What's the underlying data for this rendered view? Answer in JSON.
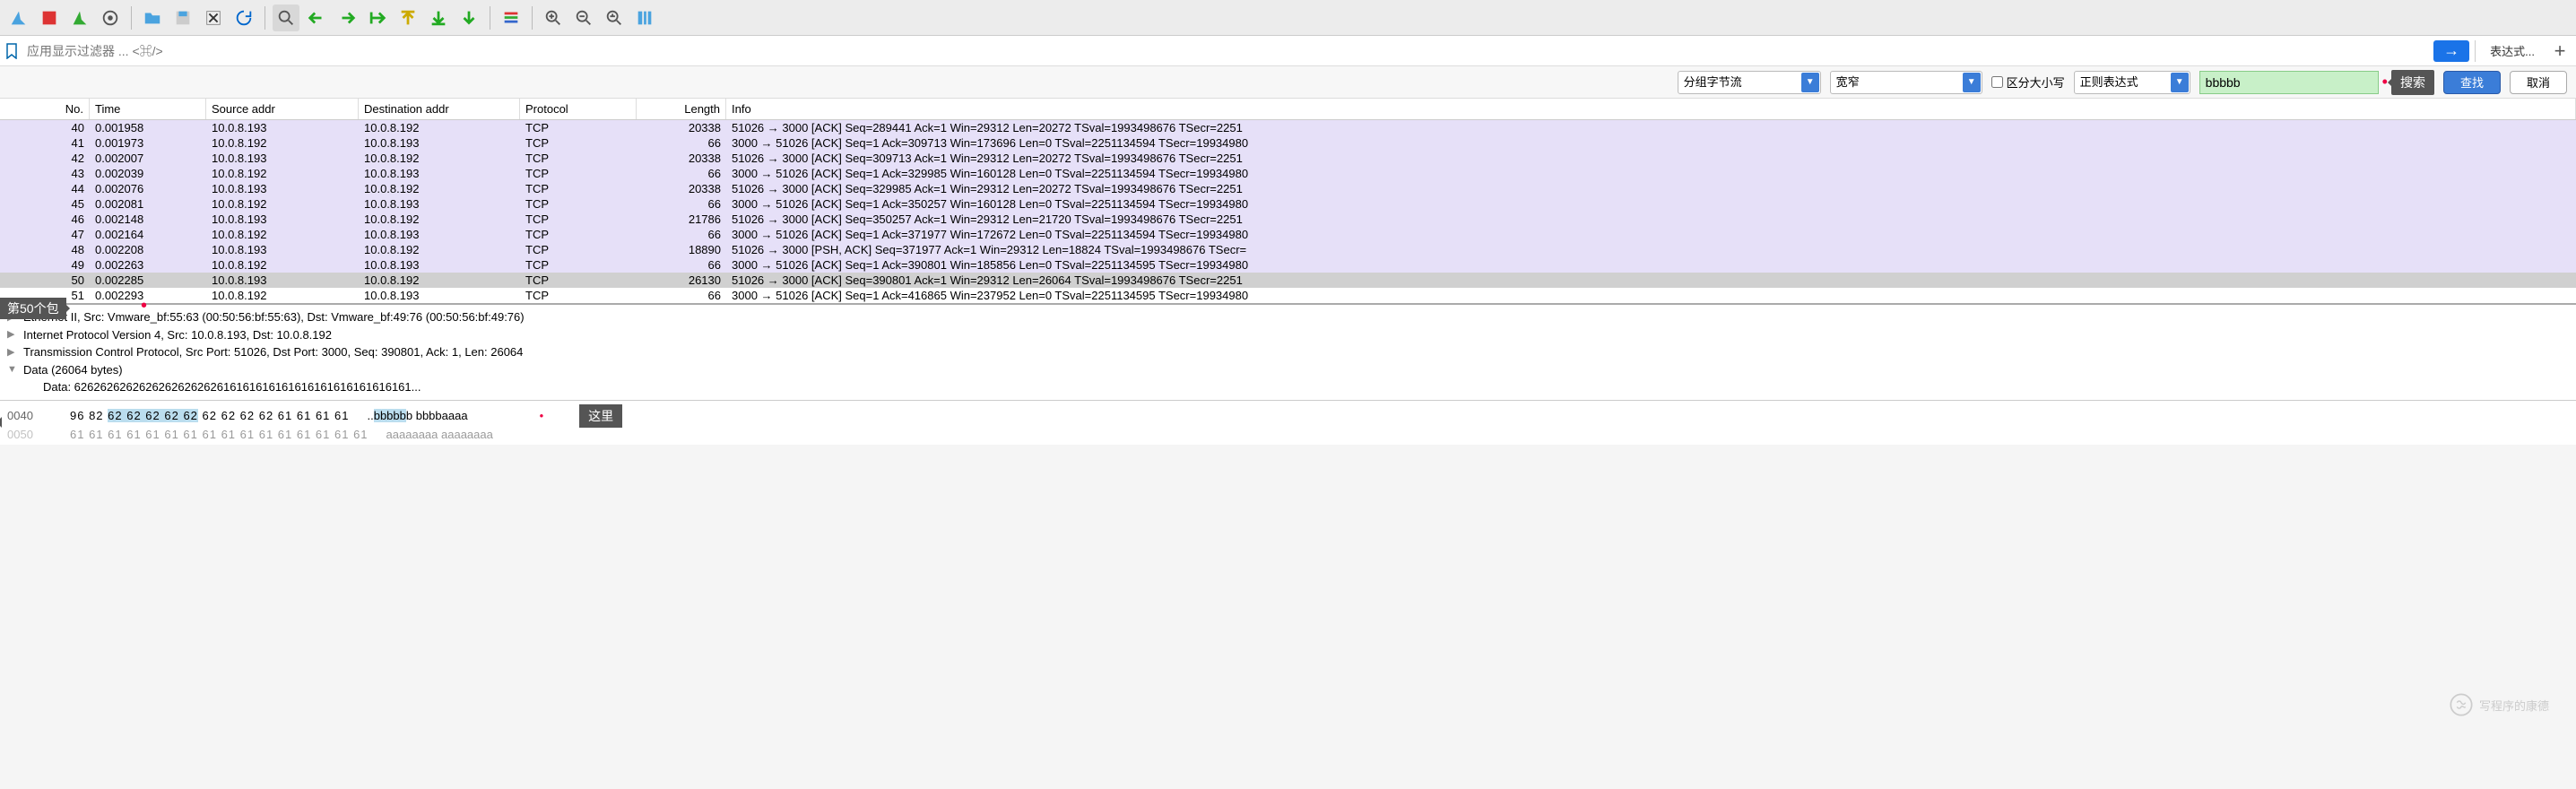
{
  "filter_placeholder": "应用显示过滤器 ... <⌘/>",
  "expression_btn": "表达式...",
  "search": {
    "stream_sel": "分组字节流",
    "width_sel": "宽窄",
    "case_label": "区分大小写",
    "mode_sel": "正则表达式",
    "term": "bbbbb",
    "search_tag": "搜索",
    "find_btn": "查找",
    "cancel_btn": "取消"
  },
  "columns": {
    "no": "No.",
    "time": "Time",
    "src": "Source addr",
    "dst": "Destination addr",
    "proto": "Protocol",
    "len": "Length",
    "info": "Info"
  },
  "overlay50": "第50个包",
  "packets": [
    {
      "no": "40",
      "time": "0.001958",
      "src": "10.0.8.193",
      "dst": "10.0.8.192",
      "proto": "TCP",
      "len": "20338",
      "info": "51026 → 3000 [ACK] Seq=289441 Ack=1 Win=29312 Len=20272 TSval=1993498676 TSecr=2251"
    },
    {
      "no": "41",
      "time": "0.001973",
      "src": "10.0.8.192",
      "dst": "10.0.8.193",
      "proto": "TCP",
      "len": "66",
      "info": "3000 → 51026 [ACK] Seq=1 Ack=309713 Win=173696 Len=0 TSval=2251134594 TSecr=19934980"
    },
    {
      "no": "42",
      "time": "0.002007",
      "src": "10.0.8.193",
      "dst": "10.0.8.192",
      "proto": "TCP",
      "len": "20338",
      "info": "51026 → 3000 [ACK] Seq=309713 Ack=1 Win=29312 Len=20272 TSval=1993498676 TSecr=2251"
    },
    {
      "no": "43",
      "time": "0.002039",
      "src": "10.0.8.192",
      "dst": "10.0.8.193",
      "proto": "TCP",
      "len": "66",
      "info": "3000 → 51026 [ACK] Seq=1 Ack=329985 Win=160128 Len=0 TSval=2251134594 TSecr=19934980"
    },
    {
      "no": "44",
      "time": "0.002076",
      "src": "10.0.8.193",
      "dst": "10.0.8.192",
      "proto": "TCP",
      "len": "20338",
      "info": "51026 → 3000 [ACK] Seq=329985 Ack=1 Win=29312 Len=20272 TSval=1993498676 TSecr=2251"
    },
    {
      "no": "45",
      "time": "0.002081",
      "src": "10.0.8.192",
      "dst": "10.0.8.193",
      "proto": "TCP",
      "len": "66",
      "info": "3000 → 51026 [ACK] Seq=1 Ack=350257 Win=160128 Len=0 TSval=2251134594 TSecr=19934980"
    },
    {
      "no": "46",
      "time": "0.002148",
      "src": "10.0.8.193",
      "dst": "10.0.8.192",
      "proto": "TCP",
      "len": "21786",
      "info": "51026 → 3000 [ACK] Seq=350257 Ack=1 Win=29312 Len=21720 TSval=1993498676 TSecr=2251"
    },
    {
      "no": "47",
      "time": "0.002164",
      "src": "10.0.8.192",
      "dst": "10.0.8.193",
      "proto": "TCP",
      "len": "66",
      "info": "3000 → 51026 [ACK] Seq=1 Ack=371977 Win=172672 Len=0 TSval=2251134594 TSecr=19934980"
    },
    {
      "no": "48",
      "time": "0.002208",
      "src": "10.0.8.193",
      "dst": "10.0.8.192",
      "proto": "TCP",
      "len": "18890",
      "info": "51026 → 3000 [PSH, ACK] Seq=371977 Ack=1 Win=29312 Len=18824 TSval=1993498676 TSecr="
    },
    {
      "no": "49",
      "time": "0.002263",
      "src": "10.0.8.192",
      "dst": "10.0.8.193",
      "proto": "TCP",
      "len": "66",
      "info": "3000 → 51026 [ACK] Seq=1 Ack=390801 Win=185856 Len=0 TSval=2251134595 TSecr=19934980"
    },
    {
      "no": "50",
      "time": "0.002285",
      "src": "10.0.8.193",
      "dst": "10.0.8.192",
      "proto": "TCP",
      "len": "26130",
      "info": "51026 → 3000 [ACK] Seq=390801 Ack=1 Win=29312 Len=26064 TSval=1993498676 TSecr=2251",
      "sel": true
    },
    {
      "no": "51",
      "time": "0.002293",
      "src": "10.0.8.192",
      "dst": "10.0.8.193",
      "proto": "TCP",
      "len": "66",
      "info": "3000 → 51026 [ACK] Seq=1 Ack=416865 Win=237952 Len=0 TSval=2251134595 TSecr=19934980",
      "last": true
    }
  ],
  "detail": {
    "l0": "Ethernet II, Src: Vmware_bf:55:63 (00:50:56:bf:55:63), Dst: Vmware_bf:49:76 (00:50:56:bf:49:76)",
    "l1": "Internet Protocol Version 4, Src: 10.0.8.193, Dst: 10.0.8.192",
    "l2": "Transmission Control Protocol, Src Port: 51026, Dst Port: 3000, Seq: 390801, Ack: 1, Len: 26064",
    "l3": "Data (26064 bytes)",
    "l4": "Data: 6262626262626262626262616161616161616161616161616161..."
  },
  "hex": {
    "off0": "0040",
    "b0a": "96 82 ",
    "b0b": "62 62 62 62 62",
    "b0c": "  62 62 62 62 61 61 61 61",
    "a0a": "..",
    "a0b": "bbbbb",
    "a0c": "b bbbbaaaa",
    "off1": "0050",
    "b1": "61 61 61 61 61 61 61 61  61 61 61 61 61 61 61 61",
    "a1": "aaaaaaaa aaaaaaaa"
  },
  "here_tag": "这里",
  "watermark": "写程序的康德"
}
